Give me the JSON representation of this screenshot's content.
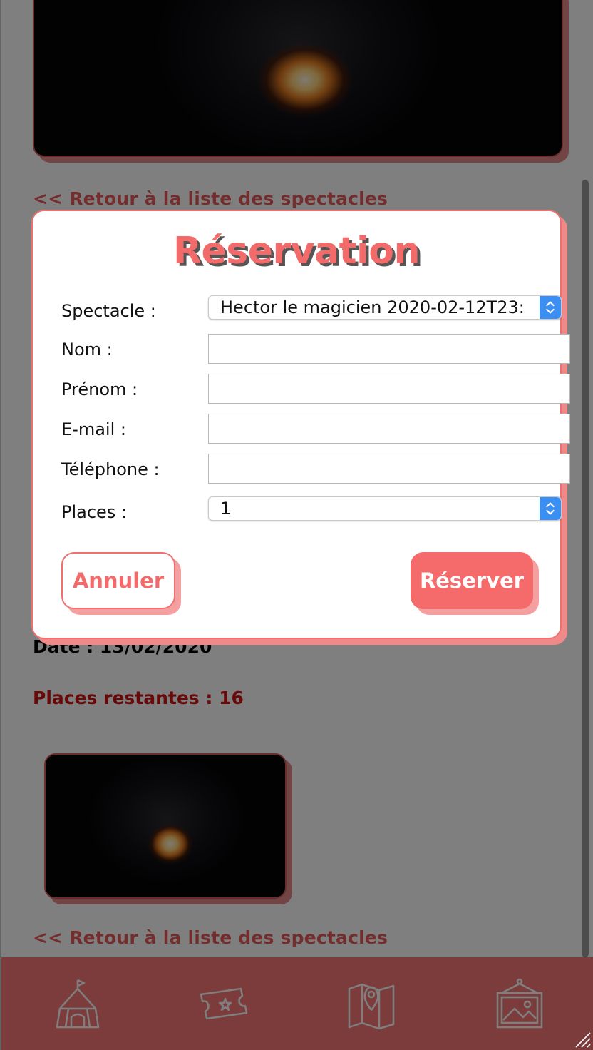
{
  "page": {
    "back_link_label": "<< Retour à la liste des spectacles",
    "date_label": "Date : 13/02/2020",
    "places_left_label": "Places restantes : 16"
  },
  "modal": {
    "title": "Réservation",
    "fields": {
      "spectacle": {
        "label": "Spectacle :",
        "value": "Hector le magicien 2020-02-12T23:"
      },
      "nom": {
        "label": "Nom :",
        "value": ""
      },
      "prenom": {
        "label": "Prénom :",
        "value": ""
      },
      "email": {
        "label": "E-mail :",
        "value": ""
      },
      "telephone": {
        "label": "Téléphone :",
        "value": ""
      },
      "places": {
        "label": "Places :",
        "value": "1"
      }
    },
    "cancel_label": "Annuler",
    "reserve_label": "Réserver"
  },
  "tabbar": {
    "items": [
      {
        "icon": "circus-tent-icon"
      },
      {
        "icon": "ticket-icon"
      },
      {
        "icon": "map-pin-icon"
      },
      {
        "icon": "gallery-frame-icon"
      }
    ]
  },
  "colors": {
    "accent": "#f26a6a",
    "accent_shadow": "#ee8a8a",
    "places_left": "#d01010",
    "tabbar": "#fa7878",
    "stepper_blue": "#3b8ef2"
  }
}
